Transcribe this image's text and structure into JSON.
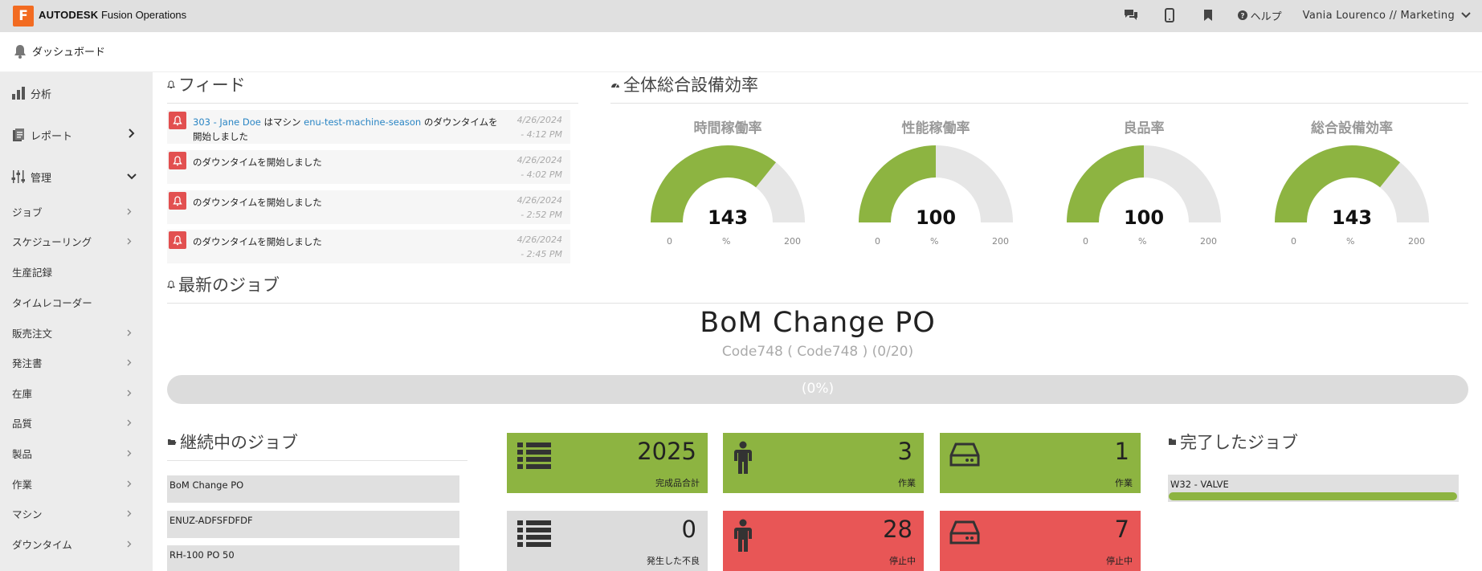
{
  "topbar": {
    "logo_letter": "F",
    "brand_bold": "AUTODESK",
    "brand_rest": "Fusion Operations",
    "help_label": "ヘルプ",
    "user_label": "Vania Lourenco // Marketing"
  },
  "subheader": {
    "title": "ダッシュボード"
  },
  "sidebar": {
    "main": [
      {
        "label": "分析"
      },
      {
        "label": "レポート"
      },
      {
        "label": "管理"
      }
    ],
    "sub": [
      {
        "label": "ジョブ"
      },
      {
        "label": "スケジューリング"
      },
      {
        "label": "生産記録"
      },
      {
        "label": "タイムレコーダー"
      },
      {
        "label": "販売注文"
      },
      {
        "label": "発注書"
      },
      {
        "label": "在庫"
      },
      {
        "label": "品質"
      },
      {
        "label": "製品"
      },
      {
        "label": "作業"
      },
      {
        "label": "マシン"
      },
      {
        "label": "ダウンタイム"
      }
    ]
  },
  "feed": {
    "title": "フィード",
    "items": [
      {
        "link1": "303 - Jane Doe",
        "text1": " はマシン ",
        "link2": "enu-test-machine-season",
        "text2": " のダウンタイムを開始しました",
        "date": "4/26/2024",
        "time": "- 4:12 PM"
      },
      {
        "text": "のダウンタイムを開始しました",
        "date": "4/26/2024",
        "time": "- 4:02 PM"
      },
      {
        "text": "のダウンタイムを開始しました",
        "date": "4/26/2024",
        "time": "- 2:52 PM"
      },
      {
        "text": "のダウンタイムを開始しました",
        "date": "4/26/2024",
        "time": "- 2:45 PM"
      }
    ]
  },
  "oee": {
    "title": "全体総合設備効率",
    "gauges": [
      {
        "title": "時間稼働率",
        "value": 143,
        "display": "143",
        "min": "0",
        "max": "200",
        "unit": "%"
      },
      {
        "title": "性能稼働率",
        "value": 100,
        "display": "100",
        "min": "0",
        "max": "200",
        "unit": "%"
      },
      {
        "title": "良品率",
        "value": 100,
        "display": "100",
        "min": "0",
        "max": "200",
        "unit": "%"
      },
      {
        "title": "総合設備効率",
        "value": 143,
        "display": "143",
        "min": "0",
        "max": "200",
        "unit": "%"
      }
    ]
  },
  "latest_job": {
    "title": "最新のジョブ",
    "name": "BoM Change PO",
    "sub": "Code748 ( Code748 ) (0/20)",
    "progress_percent": 0,
    "progress_label": "(0%)"
  },
  "ongoing": {
    "title": "継続中のジョブ",
    "items": [
      "BoM Change PO",
      "ENUZ-ADFSFDFDF",
      "RH-100 PO 50"
    ]
  },
  "tiles": [
    {
      "icon": "list-icon",
      "value": "2025",
      "label": "完成品合計",
      "status": "green"
    },
    {
      "icon": "person-icon",
      "value": "3",
      "label": "作業",
      "status": "green"
    },
    {
      "icon": "machine-icon",
      "value": "1",
      "label": "作業",
      "status": "green"
    },
    {
      "icon": "list-icon",
      "value": "0",
      "label": "発生した不良",
      "status": "gray"
    },
    {
      "icon": "person-icon",
      "value": "28",
      "label": "停止中",
      "status": "red"
    },
    {
      "icon": "machine-icon",
      "value": "7",
      "label": "停止中",
      "status": "red"
    }
  ],
  "completed": {
    "title": "完了したジョブ",
    "items": [
      {
        "name": "W32 - VALVE",
        "progress_percent": 100
      }
    ]
  },
  "colors": {
    "green": "#8db441",
    "red": "#e85656",
    "gray": "#dcdcdc",
    "accent": "#f26b21",
    "link": "#2a85c4"
  }
}
